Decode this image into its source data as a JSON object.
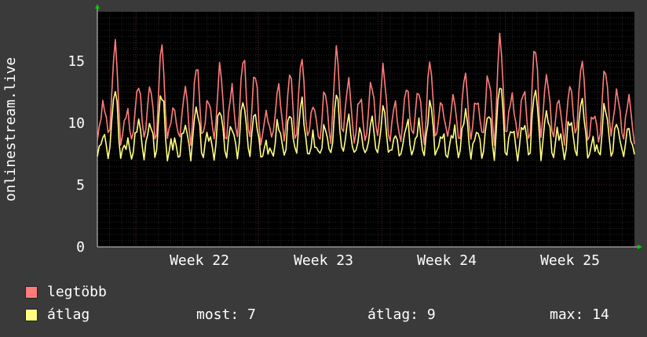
{
  "chart_data": {
    "type": "line",
    "ylabel": "onlinestream.live",
    "ylim": [
      0,
      19
    ],
    "yticks": [
      "0",
      "5",
      "10",
      "15"
    ],
    "xticks": [
      "Week 22",
      "Week 23",
      "Week 24",
      "Week 25"
    ],
    "grid": true,
    "series": [
      {
        "name": "legtöbb",
        "color": "#ff7b7b"
      },
      {
        "name": "átlag",
        "color": "#ffff80"
      }
    ],
    "peaks_max": [
      11.5,
      16.3,
      10.8,
      13.0,
      12.8,
      16.1,
      11.0,
      12.6,
      14.5,
      11.7,
      14.3,
      12.5,
      15.1,
      13.8,
      10.5,
      12.7,
      13.7,
      15.0,
      11.2,
      12.3,
      15.7,
      13.2,
      11.9,
      13.1,
      14.3,
      11.4,
      12.8,
      12.6,
      14.9,
      11.6,
      12.1,
      14.0,
      12.0,
      13.9,
      17.0,
      12.3,
      12.8,
      16.4,
      14.0,
      12.0,
      13.2,
      15.3,
      10.9,
      14.6,
      12.7,
      12.2
    ]
  },
  "legend": {
    "max_label": "legtöbb",
    "avg_label": "átlag",
    "max_color": "#ff7b7b",
    "avg_color": "#ffff80"
  },
  "stats": {
    "now": "most: 7",
    "avg": "átlag: 9",
    "max": "max: 14"
  }
}
